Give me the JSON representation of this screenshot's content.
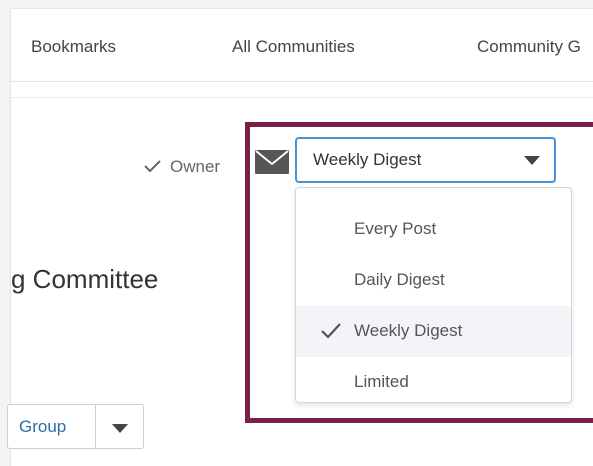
{
  "nav": {
    "items": [
      {
        "label": "Bookmarks"
      },
      {
        "label": "All Communities"
      },
      {
        "label": "Community G"
      }
    ]
  },
  "membership": {
    "owner_label": "Owner"
  },
  "community": {
    "title_fragment": "g Committee"
  },
  "group_button": {
    "label": "Group"
  },
  "subscription": {
    "selected": "Weekly Digest",
    "options": [
      {
        "label": "Every Post",
        "selected": false
      },
      {
        "label": "Daily Digest",
        "selected": false
      },
      {
        "label": "Weekly Digest",
        "selected": true
      },
      {
        "label": "Limited",
        "selected": false
      }
    ]
  },
  "colors": {
    "highlight_border": "#7a1f47",
    "select_focus": "#4b8fd6",
    "link": "#2a6fa8"
  }
}
